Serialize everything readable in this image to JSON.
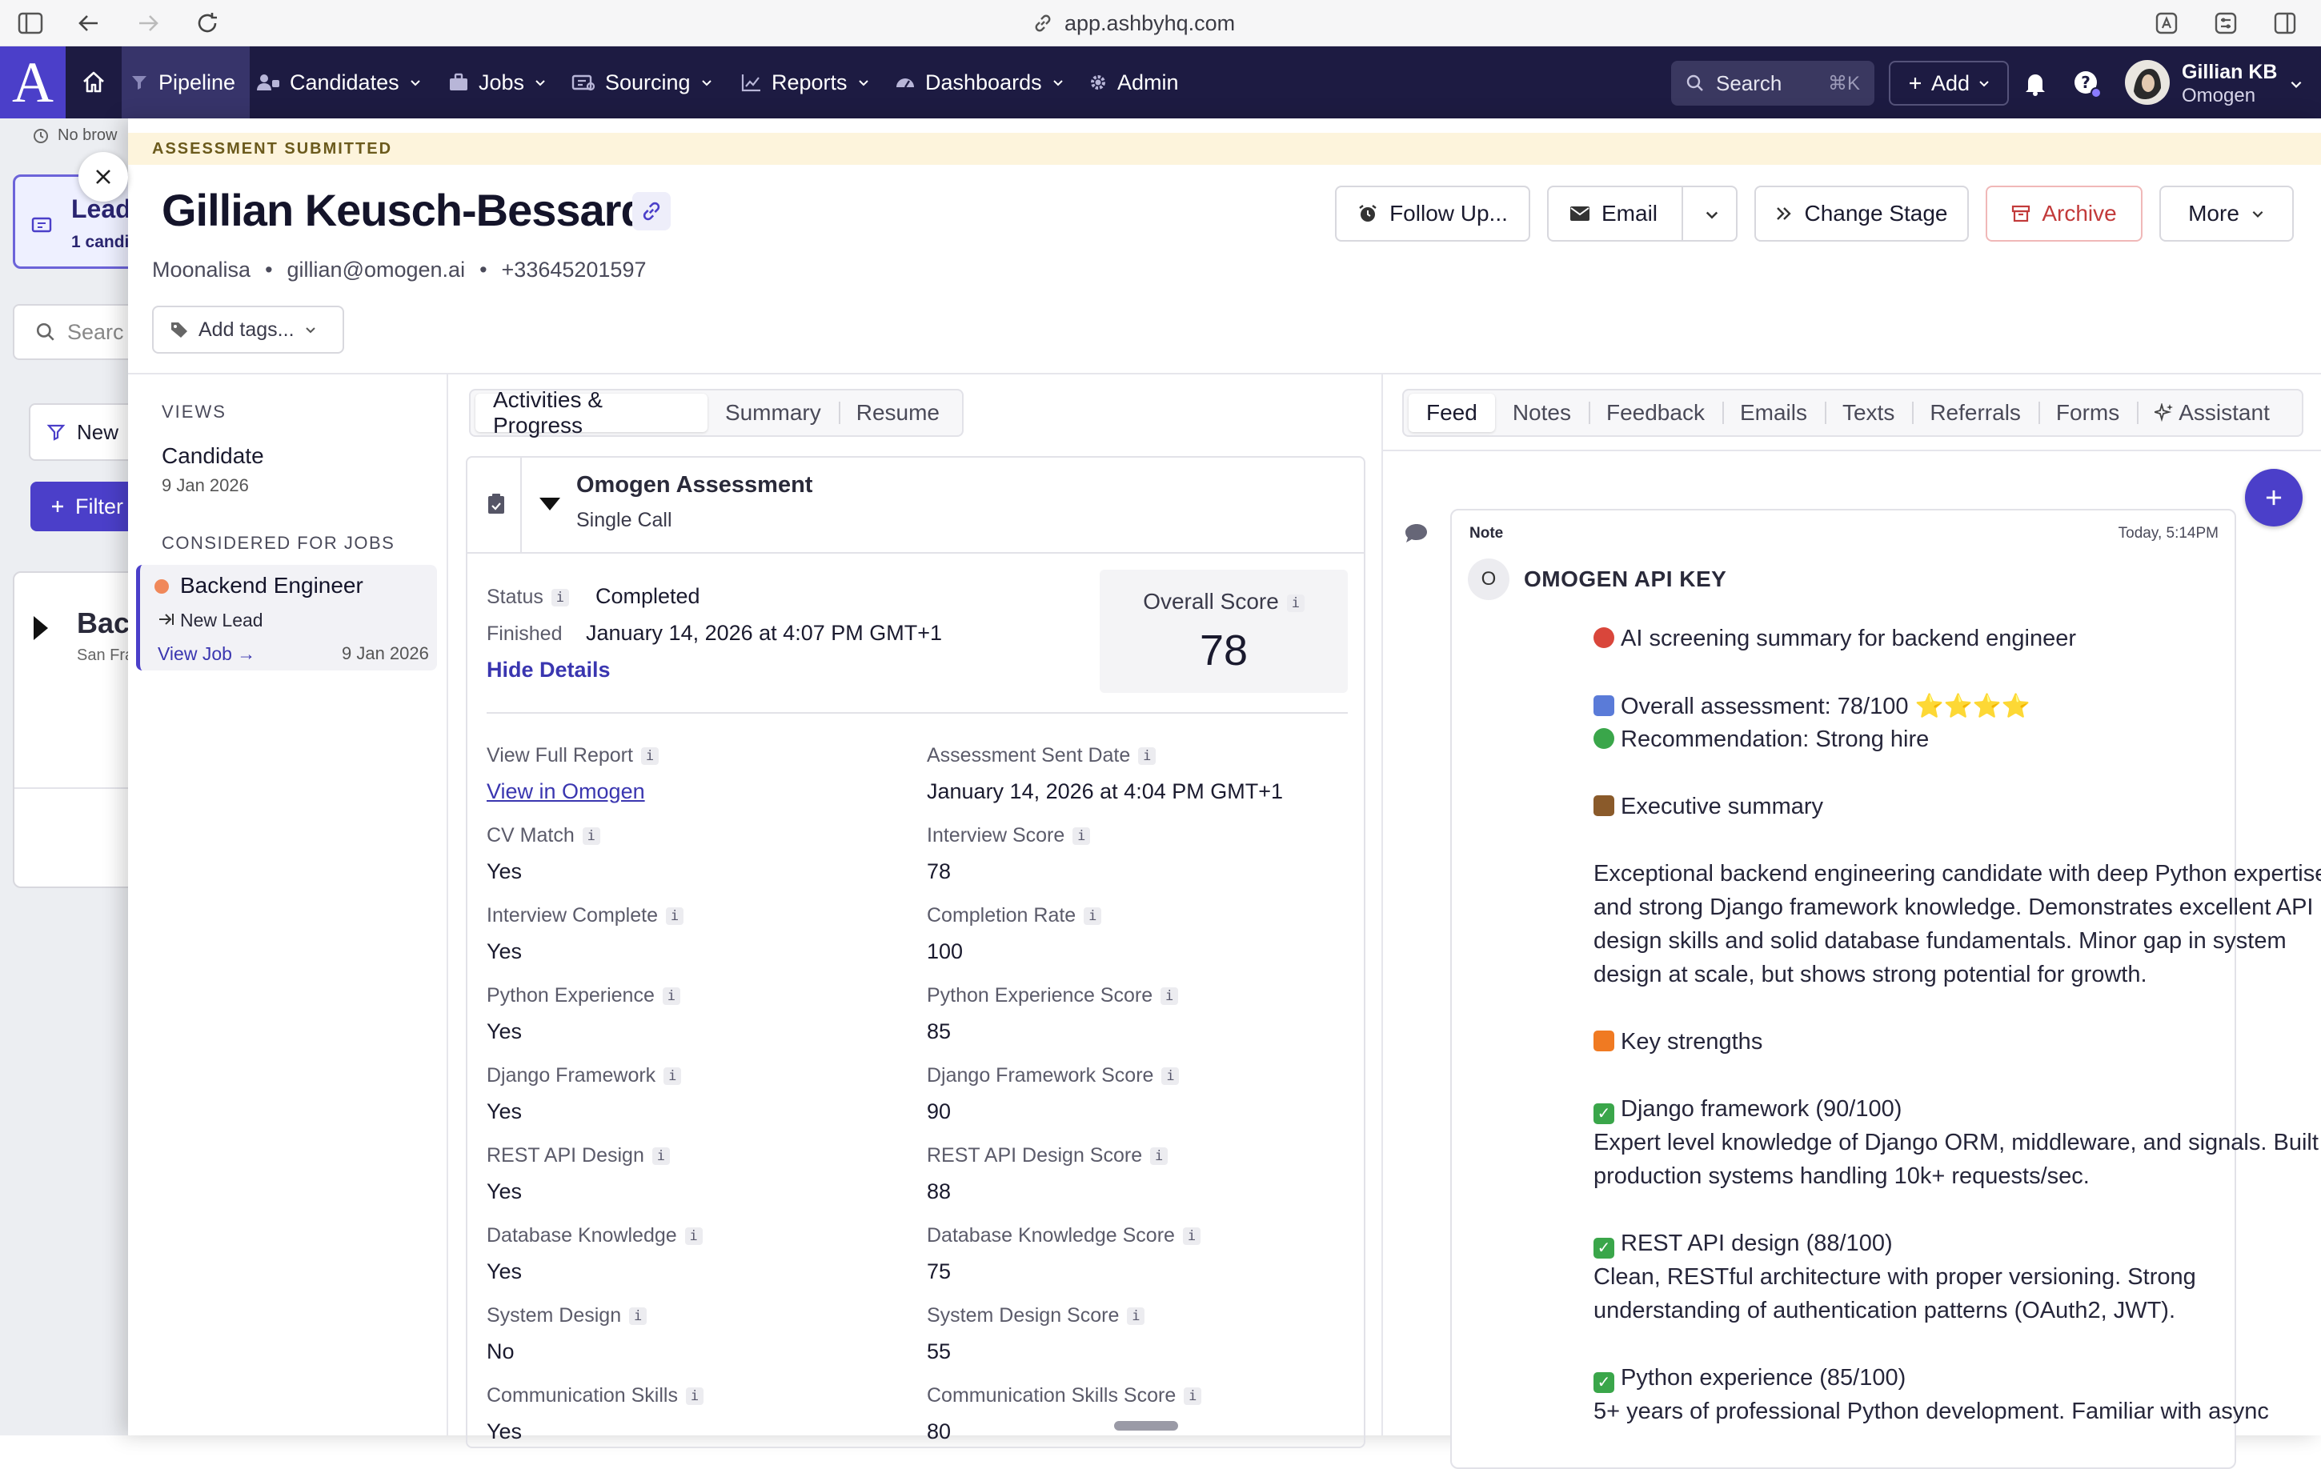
{
  "browser": {
    "url": "app.ashbyhq.com"
  },
  "nav": {
    "logo": "A",
    "items": [
      {
        "label": "Pipeline"
      },
      {
        "label": "Candidates"
      },
      {
        "label": "Jobs"
      },
      {
        "label": "Sourcing"
      },
      {
        "label": "Reports"
      },
      {
        "label": "Dashboards"
      },
      {
        "label": "Admin"
      }
    ],
    "search": {
      "label": "Search",
      "shortcut": "⌘K"
    },
    "add_label": "Add",
    "user": {
      "name": "Gillian KB",
      "org": "Omogen"
    }
  },
  "left_panel": {
    "history": "No brow",
    "leads_title": "Lead",
    "leads_sub": "1 candi",
    "search_placeholder": "Searc",
    "new_label": "New",
    "filter_label": "Filter",
    "job_title": "Bac",
    "job_sub": "San Fra"
  },
  "banner": "ASSESSMENT SUBMITTED",
  "candidate": {
    "name": "Gillian Keusch-Bessard",
    "company": "Moonalisa",
    "email": "gillian@omogen.ai",
    "phone": "+33645201597",
    "add_tags": "Add tags..."
  },
  "actions": {
    "follow_up": "Follow Up...",
    "email": "Email",
    "change_stage": "Change Stage",
    "archive": "Archive",
    "more": "More"
  },
  "views": {
    "heading": "VIEWS",
    "candidate_label": "Candidate",
    "candidate_date": "9 Jan 2026",
    "jobs_heading": "CONSIDERED FOR JOBS",
    "job_title": "Backend Engineer",
    "job_stage": "New Lead",
    "view_job": "View Job →",
    "job_date": "9 Jan 2026"
  },
  "center_tabs": [
    "Activities & Progress",
    "Summary",
    "Resume"
  ],
  "assessment": {
    "title": "Omogen Assessment",
    "subtitle": "Single Call",
    "status_label": "Status",
    "status_value": "Completed",
    "finished_label": "Finished",
    "finished_value": "January 14, 2026 at 4:07 PM GMT+1",
    "hide_details": "Hide Details",
    "overall_label": "Overall Score",
    "overall_value": "78",
    "fields": [
      {
        "label": "View Full Report",
        "value": "View in Omogen",
        "link": true
      },
      {
        "label": "Assessment Sent Date",
        "value": "January 14, 2026 at 4:04 PM GMT+1"
      },
      {
        "label": "CV Match",
        "value": "Yes"
      },
      {
        "label": "Interview Score",
        "value": "78"
      },
      {
        "label": "Interview Complete",
        "value": "Yes"
      },
      {
        "label": "Completion Rate",
        "value": "100"
      },
      {
        "label": "Python Experience",
        "value": "Yes"
      },
      {
        "label": "Python Experience Score",
        "value": "85"
      },
      {
        "label": "Django Framework",
        "value": "Yes"
      },
      {
        "label": "Django Framework Score",
        "value": "90"
      },
      {
        "label": "REST API Design",
        "value": "Yes"
      },
      {
        "label": "REST API Design Score",
        "value": "88"
      },
      {
        "label": "Database Knowledge",
        "value": "Yes"
      },
      {
        "label": "Database Knowledge Score",
        "value": "75"
      },
      {
        "label": "System Design",
        "value": "No"
      },
      {
        "label": "System Design Score",
        "value": "55"
      },
      {
        "label": "Communication Skills",
        "value": "Yes"
      },
      {
        "label": "Communication Skills Score",
        "value": "80"
      }
    ]
  },
  "right_tabs": [
    "Feed",
    "Notes",
    "Feedback",
    "Emails",
    "Texts",
    "Referrals",
    "Forms",
    "Assistant"
  ],
  "note": {
    "type": "Note",
    "time": "Today, 5:14PM",
    "avatar": "O",
    "author": "OMOGEN API KEY",
    "lines": [
      {
        "icon": "target-emoji-icon",
        "text": "AI screening summary for backend engineer"
      },
      {
        "icon": "chart-emoji-icon",
        "text": "Overall assessment: 78/100 ⭐⭐⭐⭐"
      },
      {
        "icon": "green-circle-emoji-icon",
        "text": "Recommendation: Strong hire"
      },
      {
        "icon": "briefcase-emoji-icon",
        "text": "Executive summary"
      },
      {
        "icon": "",
        "text": "Exceptional backend engineering candidate with deep Python expertise"
      },
      {
        "icon": "",
        "text": "and strong Django framework knowledge. Demonstrates excellent API"
      },
      {
        "icon": "",
        "text": "design skills and solid database fundamentals. Minor gap in system"
      },
      {
        "icon": "",
        "text": "design at scale, but shows strong potential for growth."
      },
      {
        "icon": "fire-emoji-icon",
        "text": "Key strengths"
      },
      {
        "icon": "check-emoji-icon",
        "text": "Django framework (90/100)"
      },
      {
        "icon": "",
        "text": "Expert level knowledge of Django ORM, middleware, and signals. Built"
      },
      {
        "icon": "",
        "text": "production systems handling 10k+ requests/sec."
      },
      {
        "icon": "check-emoji-icon",
        "text": "REST API design (88/100)"
      },
      {
        "icon": "",
        "text": "Clean, RESTful architecture with proper versioning. Strong"
      },
      {
        "icon": "",
        "text": "understanding of authentication patterns (OAuth2, JWT)."
      },
      {
        "icon": "check-emoji-icon",
        "text": "Python experience (85/100)"
      },
      {
        "icon": "",
        "text": "5+ years of professional Python development. Familiar with async"
      }
    ]
  },
  "colors": {
    "nav": "#1d1b42",
    "accent": "#4b3fc9",
    "archive": "#c23a3a",
    "banner": "#fdf4dc",
    "link": "#3a36b0"
  }
}
